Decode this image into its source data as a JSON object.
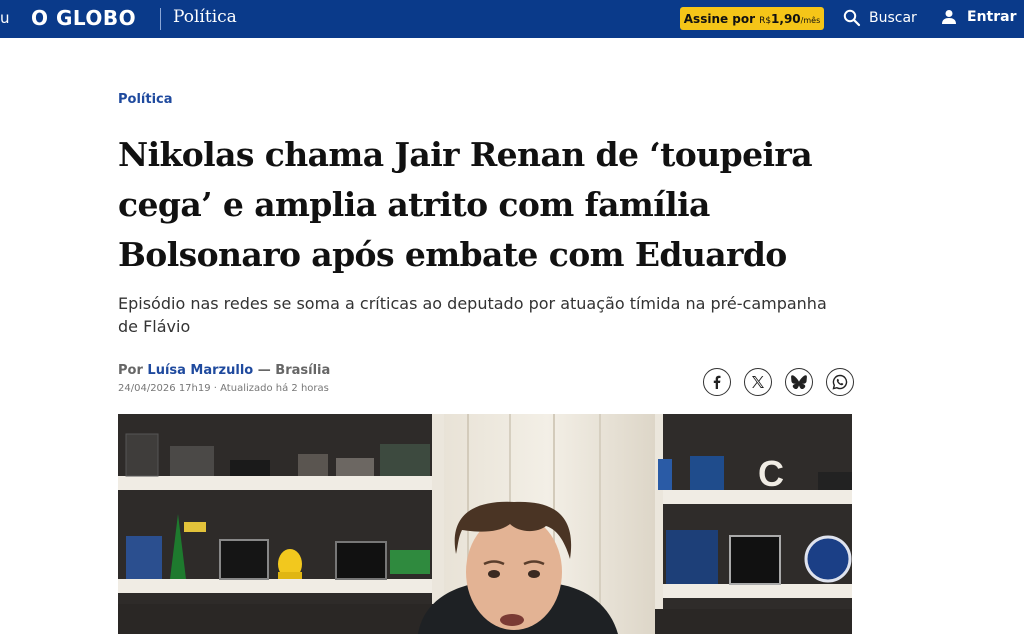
{
  "header": {
    "menu_stub": "u",
    "logo": "O GLOBO",
    "section": "Política",
    "subscribe": {
      "label": "Assine por",
      "currency": "R$",
      "price": "1,90",
      "per": "/mês"
    },
    "search_label": "Buscar",
    "login_label": "Entrar"
  },
  "article": {
    "kicker": "Política",
    "headline": "Nikolas chama Jair Renan de ‘toupeira cega’ e amplia atrito com família Bolsonaro após embate com Eduardo",
    "subhead": "Episódio nas redes se soma a críticas ao deputado por atuação tímida na pré-campanha de Flávio",
    "byline": {
      "prefix": "Por",
      "author": "Luísa Marzullo",
      "location": "— Brasília"
    },
    "meta": "24/04/2026 17h19 · Atualizado há 2 horas"
  },
  "share_icons": [
    "facebook-icon",
    "x-icon",
    "bluesky-icon",
    "whatsapp-icon"
  ],
  "colors": {
    "header_bg": "#0a3a8a",
    "accent": "#1f4a9e",
    "subscribe_bg": "#f5c518"
  }
}
